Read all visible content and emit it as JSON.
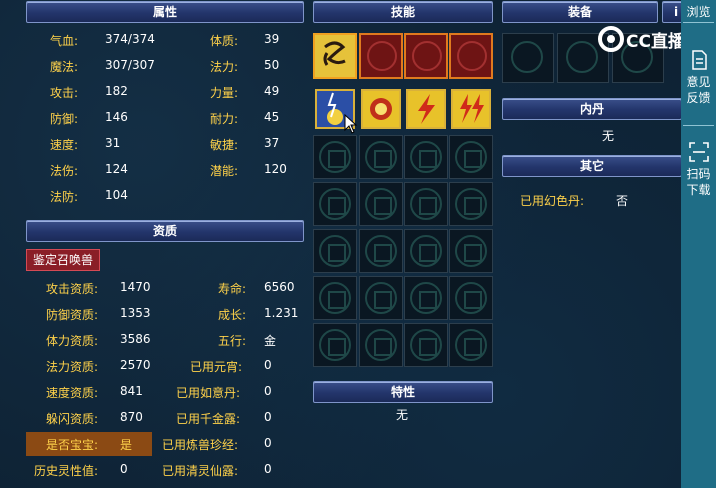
{
  "attributes": {
    "header": "属性",
    "left": [
      {
        "label": "气血:",
        "value": "374/374"
      },
      {
        "label": "魔法:",
        "value": "307/307"
      },
      {
        "label": "攻击:",
        "value": "182"
      },
      {
        "label": "防御:",
        "value": "146"
      },
      {
        "label": "速度:",
        "value": "31"
      },
      {
        "label": "法伤:",
        "value": "124"
      },
      {
        "label": "法防:",
        "value": "104"
      }
    ],
    "right": [
      {
        "label": "体质:",
        "value": "39"
      },
      {
        "label": "法力:",
        "value": "50"
      },
      {
        "label": "力量:",
        "value": "49"
      },
      {
        "label": "耐力:",
        "value": "45"
      },
      {
        "label": "敏捷:",
        "value": "37"
      },
      {
        "label": "潜能:",
        "value": "120"
      }
    ]
  },
  "aptitude": {
    "header": "资质",
    "identify_button": "鉴定召唤兽",
    "left": [
      {
        "label": "攻击资质:",
        "value": "1470"
      },
      {
        "label": "防御资质:",
        "value": "1353"
      },
      {
        "label": "体力资质:",
        "value": "3586"
      },
      {
        "label": "法力资质:",
        "value": "2570"
      },
      {
        "label": "速度资质:",
        "value": "841"
      },
      {
        "label": "躲闪资质:",
        "value": "870"
      },
      {
        "label": "是否宝宝:",
        "value": "是"
      },
      {
        "label": "历史灵性值:",
        "value": "0"
      }
    ],
    "right": [
      {
        "label": "寿命:",
        "value": "6560"
      },
      {
        "label": "成长:",
        "value": "1.231"
      },
      {
        "label": "五行:",
        "value": "金"
      },
      {
        "label": "已用元宵:",
        "value": "0"
      },
      {
        "label": "已用如意丹:",
        "value": "0"
      },
      {
        "label": "已用千金露:",
        "value": "0"
      },
      {
        "label": "已用炼兽珍经:",
        "value": "0"
      },
      {
        "label": "已用清灵仙露:",
        "value": "0"
      }
    ]
  },
  "skills": {
    "header": "技能",
    "trait_header": "特性",
    "trait_value": "无"
  },
  "equipment": {
    "header": "装备",
    "extra_tab": "i"
  },
  "inner_pill": {
    "header": "内丹",
    "value": "无"
  },
  "other": {
    "header": "其它",
    "label": "已用幻色丹:",
    "value": "否"
  },
  "watermark": {
    "text": "CC直播"
  },
  "sidebar": {
    "browse": "浏览",
    "feedback_line1": "意见",
    "feedback_line2": "反馈",
    "scan_line1": "扫码",
    "scan_line2": "下载"
  },
  "colors": {
    "label": "#ffd24a",
    "header_bar": "#23356b",
    "sidebar": "#1f6d86",
    "treasure_bg": "#8b4a14"
  }
}
